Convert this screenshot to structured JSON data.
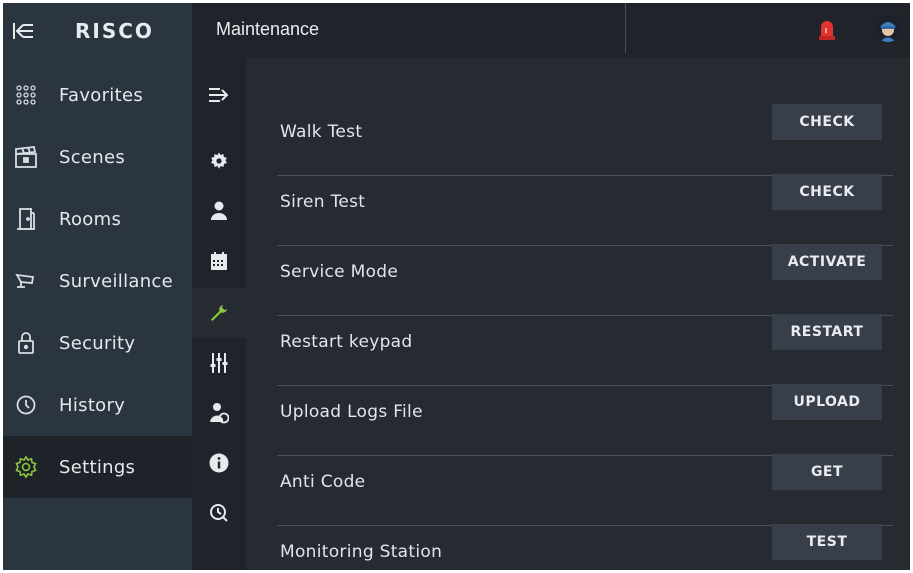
{
  "brand": {
    "logo_text": "RISCO",
    "back_icon": "arrow-left-collapse-icon"
  },
  "header": {
    "title": "Maintenance",
    "alarm_icon": "siren-alarm-icon",
    "avatar_icon": "user-avatar-icon"
  },
  "sidebar": {
    "items": [
      {
        "label": "Favorites",
        "icon": "grid-dots-icon"
      },
      {
        "label": "Scenes",
        "icon": "clapperboard-icon"
      },
      {
        "label": "Rooms",
        "icon": "door-icon"
      },
      {
        "label": "Surveillance",
        "icon": "camera-icon"
      },
      {
        "label": "Security",
        "icon": "lock-icon"
      },
      {
        "label": "History",
        "icon": "clock-history-icon"
      },
      {
        "label": "Settings",
        "icon": "gear-icon",
        "active": true
      }
    ]
  },
  "subrail": {
    "items": [
      {
        "icon": "expand-arrow-icon"
      },
      {
        "icon": "settings-gear-icon"
      },
      {
        "icon": "user-icon"
      },
      {
        "icon": "calendar-icon"
      },
      {
        "icon": "wrench-icon",
        "active": true
      },
      {
        "icon": "sliders-icon"
      },
      {
        "icon": "user-sync-icon"
      },
      {
        "icon": "info-icon"
      },
      {
        "icon": "clock-search-icon"
      }
    ]
  },
  "maintenance": {
    "rows": [
      {
        "label": "Walk Test",
        "button": "CHECK"
      },
      {
        "label": "Siren Test",
        "button": "CHECK"
      },
      {
        "label": "Service Mode",
        "button": "ACTIVATE"
      },
      {
        "label": "Restart keypad",
        "button": "RESTART"
      },
      {
        "label": "Upload Logs File",
        "button": "UPLOAD"
      },
      {
        "label": "Anti Code",
        "button": "GET"
      },
      {
        "label": "Monitoring Station",
        "button": "TEST"
      }
    ]
  },
  "colors": {
    "accent_green": "#8cc63f",
    "alarm_red": "#e2342f",
    "sidebar_bg": "#2b3540",
    "content_bg": "#262a31",
    "button_bg": "#383f4a"
  }
}
